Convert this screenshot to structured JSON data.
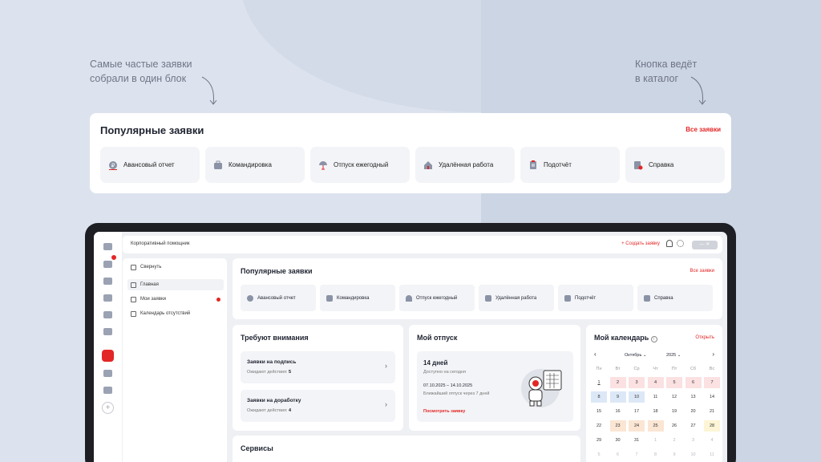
{
  "notes": {
    "left": [
      "Самые частые заявки",
      "собрали в один блок"
    ],
    "right": [
      "Кнопка ведёт",
      "в каталог"
    ]
  },
  "popular": {
    "title": "Популярные заявки",
    "all_link": "Все заявки",
    "tiles": [
      {
        "label": "Авансовый отчет",
        "icon": "coin-icon",
        "color": "#7a8499"
      },
      {
        "label": "Командировка",
        "icon": "suitcase-icon",
        "color": "#8a93a6"
      },
      {
        "label": "Отпуск ежегодный",
        "icon": "umbrella-icon",
        "color": "#8a93a6"
      },
      {
        "label": "Удалённая работа",
        "icon": "house-icon",
        "color": "#8a93a6"
      },
      {
        "label": "Подотчёт",
        "icon": "clipboard-icon",
        "color": "#8a93a6"
      },
      {
        "label": "Справка",
        "icon": "document-icon",
        "color": "#8a93a6"
      }
    ]
  },
  "app": {
    "title": "Корпоративный помощник",
    "create_button": "+ Создать заявку",
    "sidebar": {
      "collapse": "Свернуть",
      "items": [
        "Главная",
        "Мои заявки",
        "Календарь отсутствий"
      ]
    },
    "attention": {
      "title": "Требуют внимания",
      "items": [
        {
          "title": "Заявки на подпись",
          "status_prefix": "Ожидают действия:",
          "count": "5"
        },
        {
          "title": "Заявки на доработку",
          "status_prefix": "Ожидают действия:",
          "count": "4"
        }
      ]
    },
    "vacation": {
      "title": "Мой отпуск",
      "days": "14 дней",
      "available": "Доступно на сегодня",
      "range": "07.10.2025 – 14.10.2025",
      "next": "Ближайший отпуск через 7 дней",
      "link": "Посмотреть заявку"
    },
    "calendar": {
      "title": "Мой календарь",
      "open": "Открыть",
      "month": "Октябрь",
      "year": "2025",
      "weekdays": [
        "Пн",
        "Вт",
        "Ср",
        "Чт",
        "Пт",
        "Сб",
        "Вс"
      ],
      "rows": [
        [
          "1",
          "2",
          "3",
          "4",
          "5",
          "6",
          "7"
        ],
        [
          "8",
          "9",
          "10",
          "11",
          "12",
          "13",
          "14"
        ],
        [
          "15",
          "16",
          "17",
          "18",
          "19",
          "20",
          "21"
        ],
        [
          "22",
          "23",
          "24",
          "25",
          "26",
          "27",
          "28"
        ],
        [
          "29",
          "30",
          "31",
          "1",
          "2",
          "3",
          "4"
        ],
        [
          "5",
          "6",
          "7",
          "8",
          "9",
          "10",
          "11"
        ]
      ]
    },
    "services": {
      "title": "Сервисы"
    }
  },
  "colors": {
    "accent": "#e32626",
    "text": "#1f2330"
  }
}
